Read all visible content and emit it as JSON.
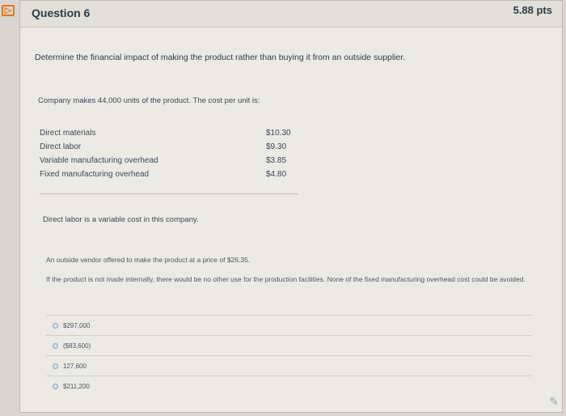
{
  "question": {
    "title": "Question 6",
    "points": "5.88 pts",
    "prompt": "Determine the financial impact of making the product rather than buying it from an outside supplier.",
    "intro": "Company makes 44,000 units of the product. The cost per unit is:",
    "costs": [
      {
        "label": "Direct materials",
        "value": "$10.30"
      },
      {
        "label": "Direct labor",
        "value": "$9.30"
      },
      {
        "label": "Variable manufacturing overhead",
        "value": "$3.85"
      },
      {
        "label": "Fixed manufacturing overhead",
        "value": "$4.80"
      }
    ],
    "note_variable": "Direct labor is a variable cost in this company.",
    "note_vendor": "An outside vendor offered to make the product at a price of $26.35.",
    "note_fixed": "If the product is not made internally, there would be no other use for the production facilities.  None of the fixed manufacturing overhead cost could be avoided."
  },
  "answers": [
    {
      "label": "$297,000"
    },
    {
      "label": "($83,600)"
    },
    {
      "label": "127,600"
    },
    {
      "label": "$211,200"
    }
  ],
  "colors": {
    "flag": "#e07b1a",
    "text": "#2d3b45"
  }
}
